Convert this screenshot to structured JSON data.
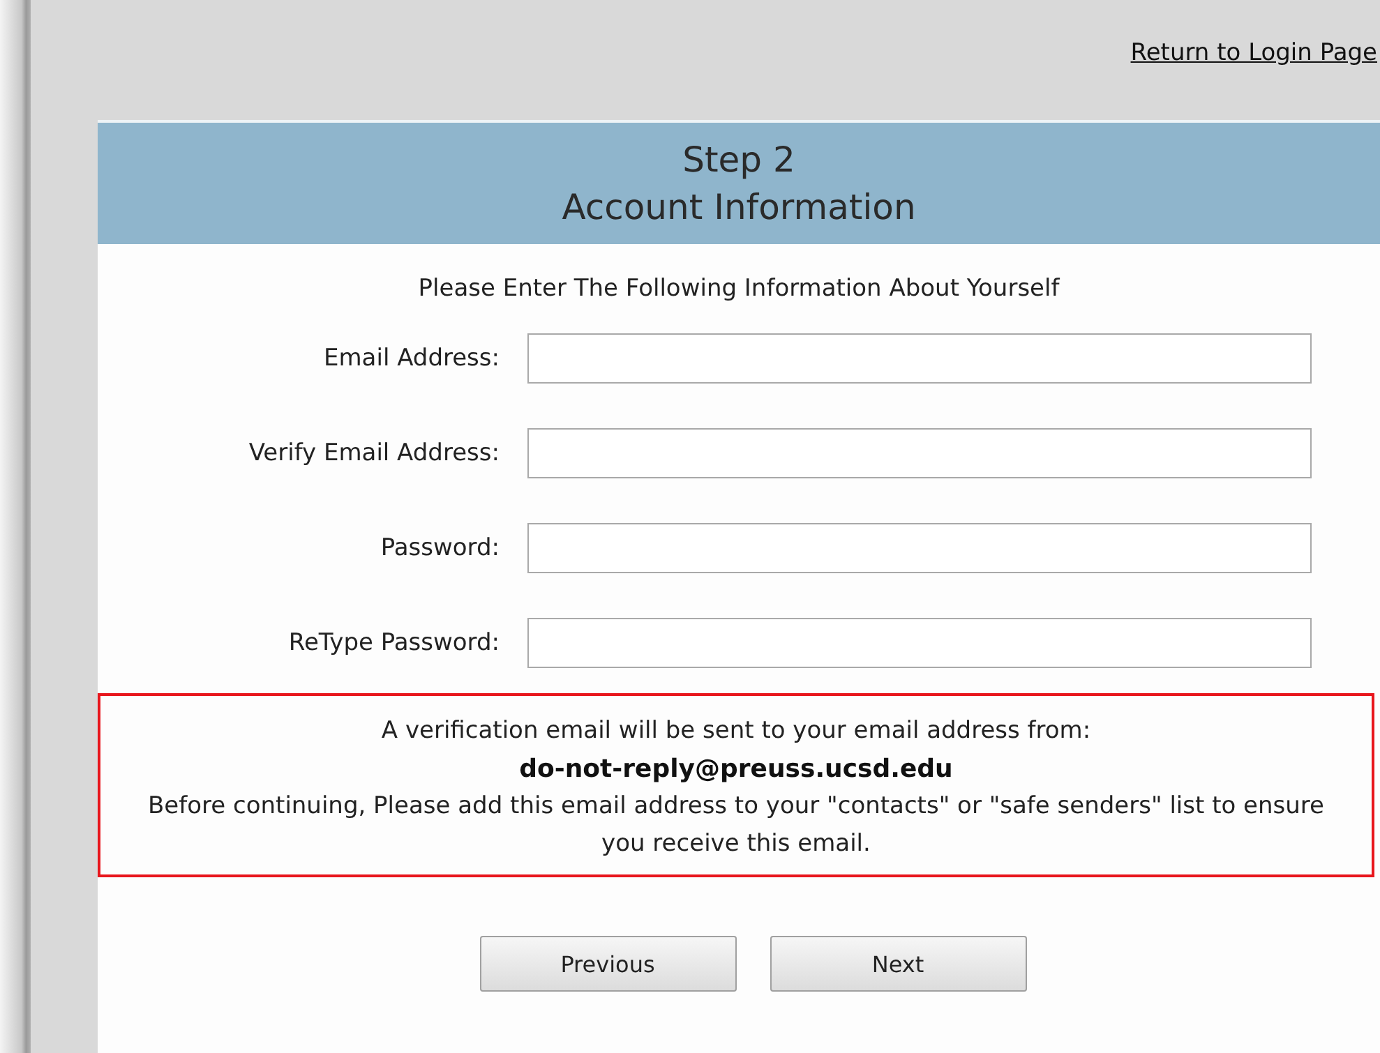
{
  "top_link": "Return to Login Page",
  "header": {
    "step": "Step 2",
    "title": "Account Information"
  },
  "intro": "Please Enter The Following Information About Yourself",
  "fields": [
    {
      "label": "Email Address:"
    },
    {
      "label": "Verify Email Address:"
    },
    {
      "label": "Password:"
    },
    {
      "label": "ReType Password:"
    }
  ],
  "notice": {
    "line": "A verification email will be sent to your email address from:",
    "email": "do-not-reply@preuss.ucsd.edu",
    "instruction": "Before continuing, Please add this email address to your \"contacts\" or \"safe senders\" list to ensure you receive this email."
  },
  "buttons": [
    "Previous",
    "Next"
  ]
}
